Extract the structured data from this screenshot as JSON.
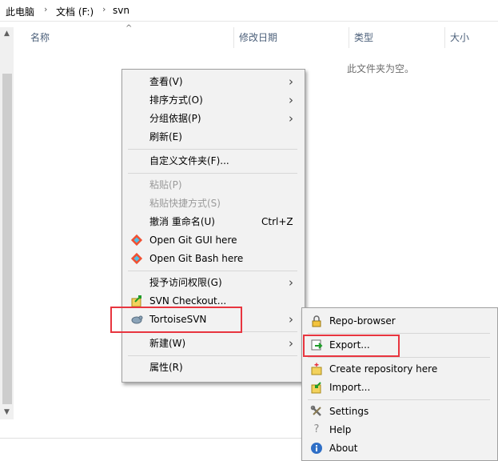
{
  "breadcrumb": {
    "root": "此电脑",
    "drive": "文档 (F:)",
    "folder": "svn"
  },
  "columns": {
    "name": "名称",
    "modified": "修改日期",
    "type": "类型",
    "size": "大小"
  },
  "empty_message": "此文件夹为空。",
  "context_menu": {
    "view": "查看(V)",
    "sort": "排序方式(O)",
    "group": "分组依据(P)",
    "refresh": "刷新(E)",
    "customize": "自定义文件夹(F)...",
    "paste": "粘贴(P)",
    "paste_shortcut": "粘贴快捷方式(S)",
    "undo": "撤消 重命名(U)",
    "undo_shortcut": "Ctrl+Z",
    "git_gui": "Open Git GUI here",
    "git_bash": "Open Git Bash here",
    "give_access": "授予访问权限(G)",
    "svn_checkout": "SVN Checkout...",
    "tortoise": "TortoiseSVN",
    "new": "新建(W)",
    "properties": "属性(R)"
  },
  "submenu": {
    "repo_browser": "Repo-browser",
    "export": "Export...",
    "create_repo": "Create repository here",
    "import": "Import...",
    "settings": "Settings",
    "help": "Help",
    "about": "About"
  },
  "colors": {
    "highlight_border": "#e8353f",
    "menu_bg": "#f2f2f2"
  }
}
